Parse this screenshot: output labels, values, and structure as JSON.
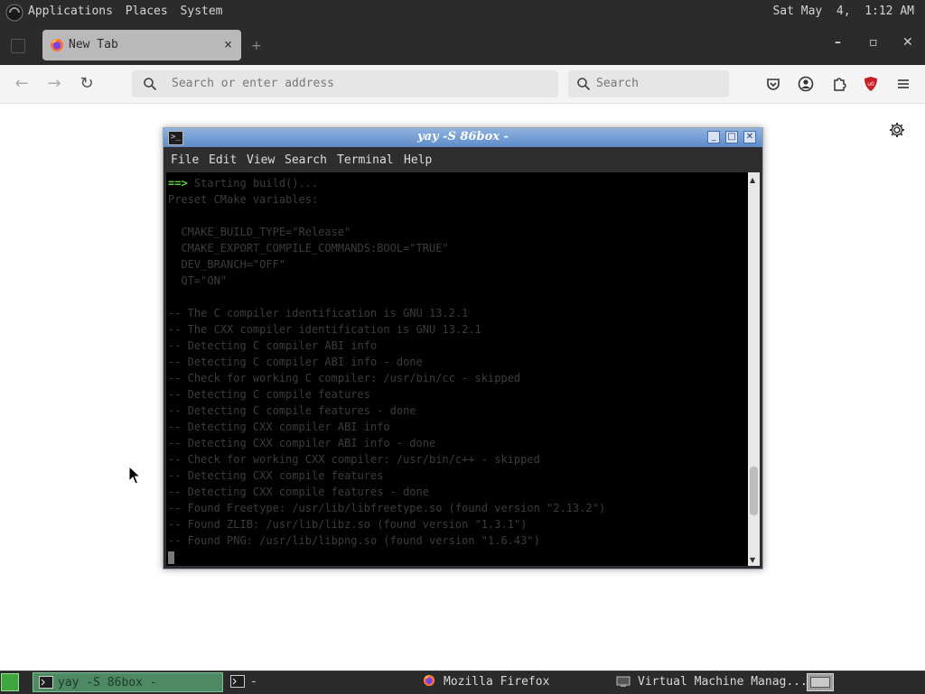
{
  "top_panel": {
    "menus": [
      "Applications",
      "Places",
      "System"
    ],
    "clock": "Sat May  4,  1:12 AM"
  },
  "browser": {
    "tab": {
      "title": "New Tab",
      "close": "×"
    },
    "new_tab": "+",
    "window_buttons": {
      "minimize": "–",
      "maximize": "▫",
      "close": "✕"
    },
    "nav": {
      "back": "←",
      "forward": "→",
      "reload": "↻"
    },
    "url_placeholder": "Search or enter address",
    "search_placeholder": "Search",
    "toolbar_icons": [
      "pocket-icon",
      "account-icon",
      "extensions-icon",
      "ublock-icon",
      "menu-icon"
    ],
    "accent_color": "#c81f26"
  },
  "terminal": {
    "title": "yay -S 86box -",
    "menu": [
      "File",
      "Edit",
      "View",
      "Search",
      "Terminal",
      "Help"
    ],
    "prompt_arrow": "==>",
    "lines": [
      "Starting build()...",
      "Preset CMake variables:",
      "",
      "  CMAKE_BUILD_TYPE=\"Release\"",
      "  CMAKE_EXPORT_COMPILE_COMMANDS:BOOL=\"TRUE\"",
      "  DEV_BRANCH=\"OFF\"",
      "  QT=\"ON\"",
      "",
      "-- The C compiler identification is GNU 13.2.1",
      "-- The CXX compiler identification is GNU 13.2.1",
      "-- Detecting C compiler ABI info",
      "-- Detecting C compiler ABI info - done",
      "-- Check for working C compiler: /usr/bin/cc - skipped",
      "-- Detecting C compile features",
      "-- Detecting C compile features - done",
      "-- Detecting CXX compiler ABI info",
      "-- Detecting CXX compiler ABI info - done",
      "-- Check for working CXX compiler: /usr/bin/c++ - skipped",
      "-- Detecting CXX compile features",
      "-- Detecting CXX compile features - done",
      "-- Found Freetype: /usr/lib/libfreetype.so (found version \"2.13.2\")",
      "-- Found ZLIB: /usr/lib/libz.so (found version \"1.3.1\")",
      "-- Found PNG: /usr/lib/libpng.so (found version \"1.6.43\")"
    ],
    "scroll_position": 0.88
  },
  "taskbar": {
    "tasks": [
      {
        "label": "yay -S 86box -",
        "active": true
      },
      {
        "label": "-",
        "active": false
      },
      {
        "label": "Mozilla Firefox",
        "active": false
      },
      {
        "label": "Virtual Machine Manag...",
        "active": false
      }
    ]
  }
}
